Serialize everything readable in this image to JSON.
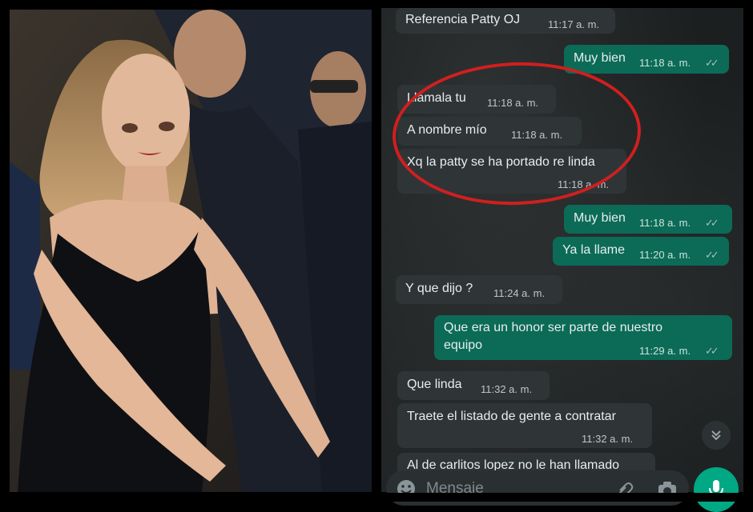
{
  "chat": {
    "messages": [
      {
        "dir": "in",
        "text": "Referencia Patty OJ",
        "time": "11:17 a. m."
      },
      {
        "dir": "out",
        "text": "Muy bien",
        "time": "11:18 a. m."
      },
      {
        "dir": "in",
        "text": "Llamala tu",
        "time": "11:18 a. m."
      },
      {
        "dir": "in",
        "text": "A nombre mío",
        "time": "11:18 a. m."
      },
      {
        "dir": "in",
        "text": "Xq la patty se ha portado re linda",
        "time": "11:18 a. m."
      },
      {
        "dir": "out",
        "text": "Muy bien",
        "time": "11:18 a. m."
      },
      {
        "dir": "out",
        "text": "Ya la llame",
        "time": "11:20 a. m."
      },
      {
        "dir": "in",
        "text": "Y que dijo ?",
        "time": "11:24 a. m."
      },
      {
        "dir": "out",
        "text_line1": "Que era un honor ser parte de nuestro",
        "text_line2": "equipo",
        "time": "11:29 a. m."
      },
      {
        "dir": "in",
        "text": "Que linda",
        "time": "11:32 a. m."
      },
      {
        "dir": "in",
        "text": "Traete el listado de gente a contratar",
        "time": "11:32 a. m."
      },
      {
        "dir": "in",
        "text": "Al de carlitos lopez no le han llamado"
      }
    ],
    "input_placeholder": "Mensaje",
    "ticks": "✓✓"
  },
  "icons": {
    "emoji": "emoji-icon",
    "attach": "paperclip-icon",
    "camera": "camera-icon",
    "mic": "microphone-icon",
    "scroll_down": "double-chevron-down-icon"
  },
  "colors": {
    "incoming_bubble": "#2f3537",
    "outgoing_bubble": "#0b6b57",
    "accent": "#00a884",
    "annotation_circle": "#d01f1f"
  }
}
